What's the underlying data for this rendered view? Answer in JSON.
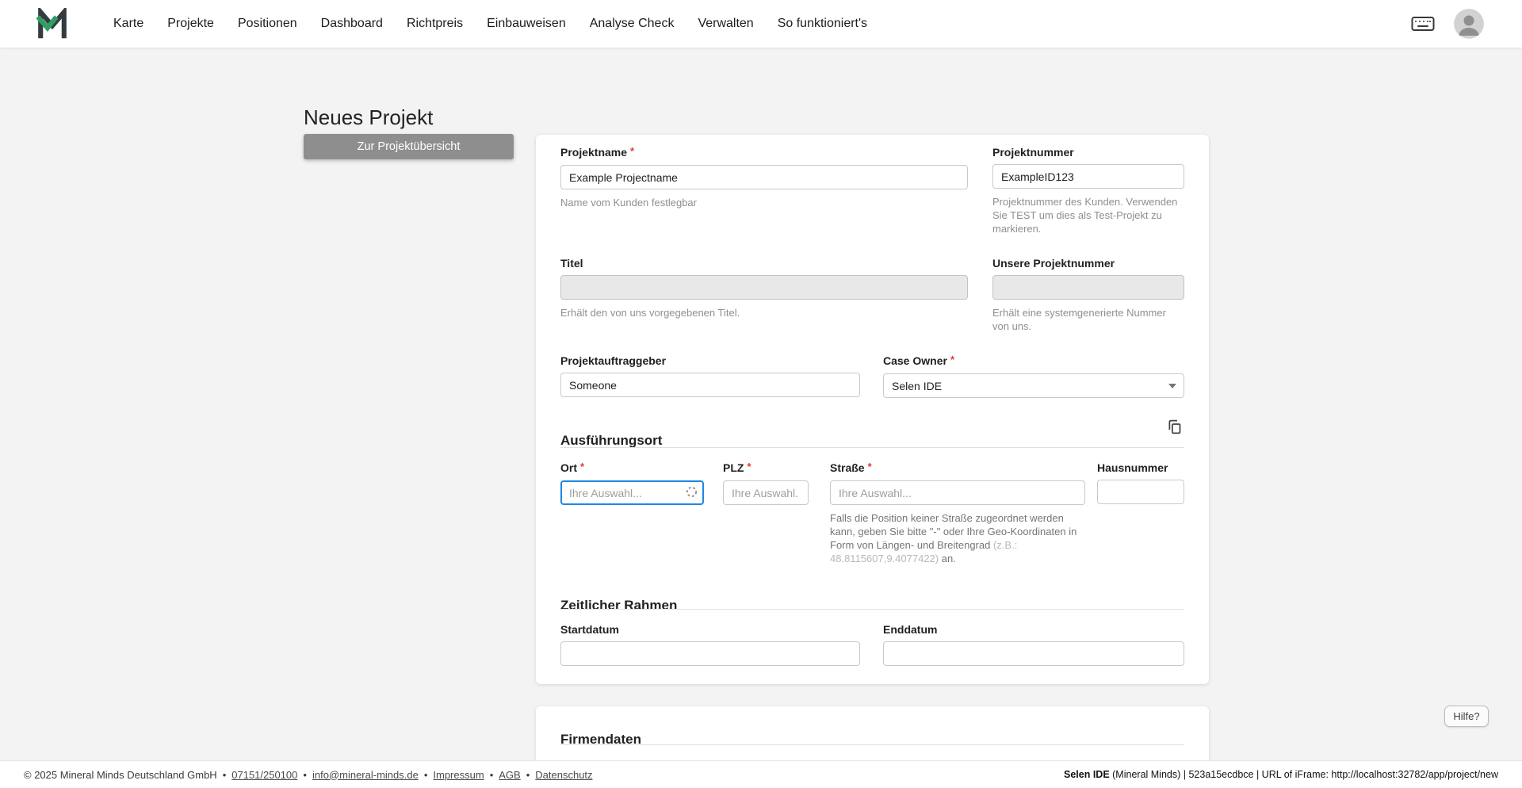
{
  "nav": {
    "items": [
      {
        "label": "Karte"
      },
      {
        "label": "Projekte"
      },
      {
        "label": "Positionen"
      },
      {
        "label": "Dashboard"
      },
      {
        "label": "Richtpreis"
      },
      {
        "label": "Einbauweisen"
      },
      {
        "label": "Analyse Check"
      },
      {
        "label": "Verwalten"
      },
      {
        "label": "So funktioniert's"
      }
    ]
  },
  "page": {
    "title": "Neues Projekt",
    "overview_button": "Zur Projektübersicht"
  },
  "form": {
    "required_mark": "*",
    "projektname": {
      "label": "Projektname",
      "value": "Example Projectname",
      "helper": "Name vom Kunden festlegbar"
    },
    "projektnummer": {
      "label": "Projektnummer",
      "value": "ExampleID123",
      "helper": "Projektnummer des Kunden. Verwenden Sie TEST um dies als Test-Projekt zu markieren."
    },
    "titel": {
      "label": "Titel",
      "helper": "Erhält den von uns vorgegebenen Titel."
    },
    "unsere_projektnummer": {
      "label": "Unsere Projektnummer",
      "helper": "Erhält eine systemgenerierte Nummer von uns."
    },
    "projektauftraggeber": {
      "label": "Projektauftraggeber",
      "value": "Someone"
    },
    "case_owner": {
      "label": "Case Owner",
      "value": "Selen IDE"
    },
    "section_ausfuehrungsort": "Ausführungsort",
    "ort": {
      "label": "Ort",
      "placeholder": "Ihre Auswahl..."
    },
    "plz": {
      "label": "PLZ",
      "placeholder": "Ihre Auswahl."
    },
    "strasse": {
      "label": "Straße",
      "placeholder": "Ihre Auswahl...",
      "helper_main": "Falls die Position keiner Straße zugeordnet werden kann, geben Sie bitte \"-\" oder Ihre Geo-Koordinaten in Form von Längen- und Breitengrad ",
      "helper_example": "(z.B.: 48.8115607,9.4077422)",
      "helper_end": " an."
    },
    "hausnummer": {
      "label": "Hausnummer"
    },
    "section_zeitlicher_rahmen": "Zeitlicher Rahmen",
    "startdatum": {
      "label": "Startdatum"
    },
    "enddatum": {
      "label": "Enddatum"
    },
    "section_firmendaten": "Firmendaten"
  },
  "help": {
    "label": "Hilfe?"
  },
  "footer": {
    "copyright": "© 2025 Mineral Minds Deutschland GmbH",
    "separator": "•",
    "links": [
      {
        "label": "07151/250100"
      },
      {
        "label": "info@mineral-minds.de"
      },
      {
        "label": "Impressum"
      },
      {
        "label": "AGB"
      },
      {
        "label": "Datenschutz"
      }
    ],
    "session_user": "Selen IDE",
    "session_rest": " (Mineral Minds) | 523a15ecdbce | URL of iFrame: http://localhost:32782/app/project/new"
  },
  "colors": {
    "logo_green": "#2f9e62",
    "focus_blue": "#1e88e5",
    "required_red": "#e53935",
    "button_gray": "#8e8e8e"
  }
}
